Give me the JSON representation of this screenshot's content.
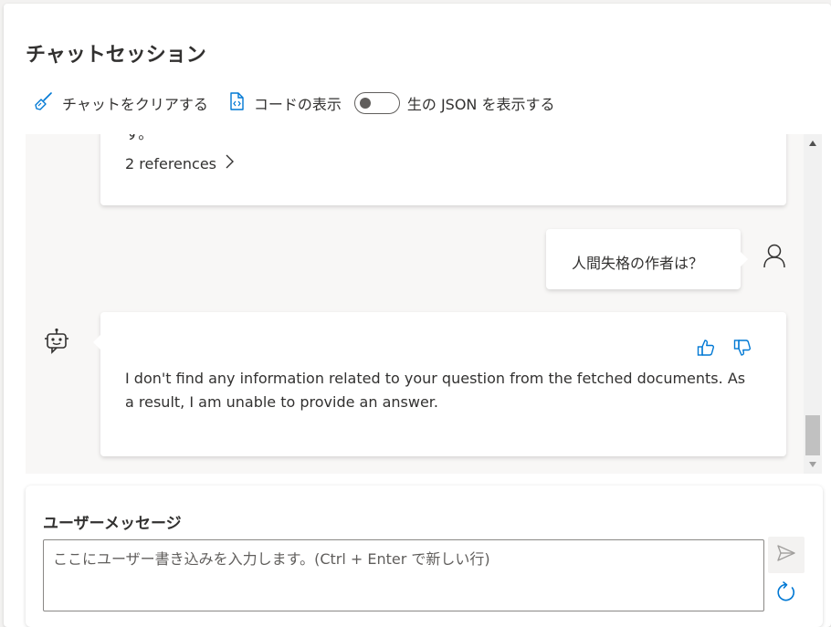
{
  "window": {
    "title": "チャットセッション"
  },
  "toolbar": {
    "clear_chat": "チャットをクリアする",
    "show_code": "コードの表示",
    "raw_json": "生の JSON を表示する",
    "raw_json_enabled": false
  },
  "chat": {
    "partial_text": "す。",
    "references_label": "2 references",
    "user_message": "人間失格の作者は？",
    "bot_message": "I don't find any information related to your question from the fetched documents. As a result, I am unable to provide an answer."
  },
  "input": {
    "label": "ユーザーメッセージ",
    "placeholder": "ここにユーザー書き込みを入力します。(Ctrl + Enter で新しい行)",
    "value": ""
  },
  "colors": {
    "accent": "#0078d4",
    "text": "#323130",
    "chat_bg": "#f8f7f6"
  },
  "icons": {
    "clear_chat": "broom-icon",
    "show_code": "code-file-icon",
    "user": "person-icon",
    "bot": "bot-icon",
    "like": "thumbs-up-icon",
    "dislike": "thumbs-down-icon",
    "send": "send-icon",
    "refresh": "refresh-icon"
  }
}
